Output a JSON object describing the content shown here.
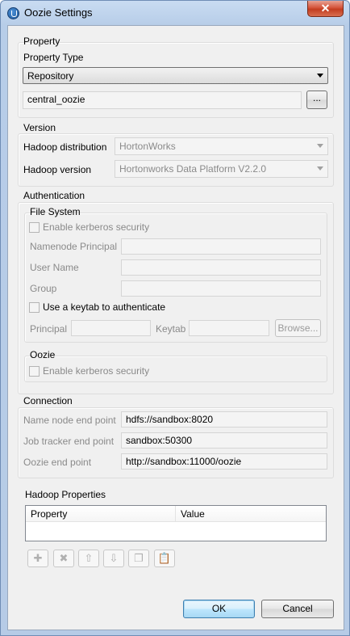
{
  "window": {
    "title": "Oozie Settings",
    "close": "✕"
  },
  "property": {
    "group_label": "Property",
    "type_label": "Property Type",
    "type_value": "Repository",
    "repo_value": "central_oozie",
    "browse_label": "..."
  },
  "version": {
    "group_label": "Version",
    "distribution_label": "Hadoop distribution",
    "distribution_value": "HortonWorks",
    "hadoop_version_label": "Hadoop version",
    "hadoop_version_value": "Hortonworks Data Platform V2.2.0"
  },
  "authentication": {
    "group_label": "Authentication",
    "filesystem": {
      "group_label": "File System",
      "kerberos_label": "Enable kerberos security",
      "namenode_principal_label": "Namenode Principal",
      "user_name_label": "User Name",
      "group_label_text": "Group",
      "keytab_label": "Use a keytab to authenticate",
      "principal_label": "Principal",
      "keytab_field_label": "Keytab",
      "browse_label": "Browse..."
    },
    "oozie": {
      "group_label": "Oozie",
      "kerberos_label": "Enable kerberos security"
    }
  },
  "connection": {
    "group_label": "Connection",
    "name_node_label": "Name node end point",
    "name_node_value": "hdfs://sandbox:8020",
    "job_tracker_label": "Job tracker end point",
    "job_tracker_value": "sandbox:50300",
    "oozie_label": "Oozie end point",
    "oozie_value": "http://sandbox:11000/oozie"
  },
  "hadoop_properties": {
    "label": "Hadoop Properties",
    "columns": [
      "Property",
      "Value"
    ],
    "toolbar_icons": [
      "add-icon",
      "delete-icon",
      "move-up-icon",
      "move-down-icon",
      "copy-icon",
      "paste-icon"
    ]
  },
  "footer": {
    "ok": "OK",
    "cancel": "Cancel"
  }
}
